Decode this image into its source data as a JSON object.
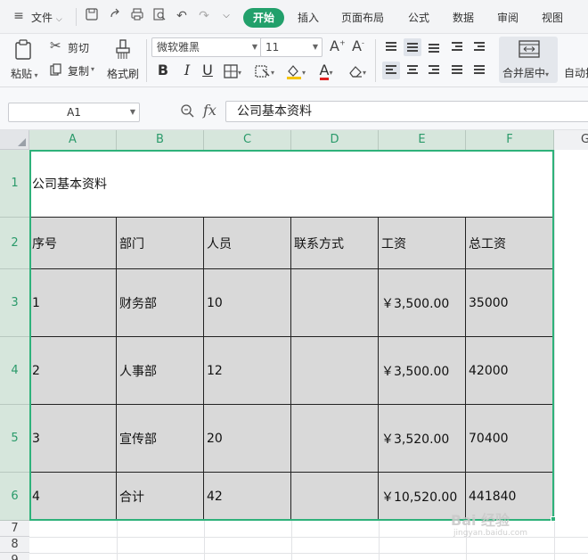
{
  "menubar": {
    "file_label": "文件",
    "tabs": [
      {
        "label": "开始",
        "active": true
      },
      {
        "label": "插入"
      },
      {
        "label": "页面布局"
      },
      {
        "label": "公式"
      },
      {
        "label": "数据"
      },
      {
        "label": "审阅"
      },
      {
        "label": "视图"
      }
    ]
  },
  "ribbon": {
    "paste": "粘贴",
    "cut": "剪切",
    "copy": "复制",
    "format_painter": "格式刷",
    "font_name": "微软雅黑",
    "font_size": "11",
    "merge_center": "合并居中",
    "auto_wrap": "自动换"
  },
  "formula_bar": {
    "name_box": "A1",
    "fx_symbol": "fx",
    "formula_value": "公司基本资料"
  },
  "sheet": {
    "columns": [
      "A",
      "B",
      "C",
      "D",
      "E",
      "F",
      "G"
    ],
    "rows": [
      "1",
      "2",
      "3",
      "4",
      "5",
      "6",
      "7",
      "8",
      "9"
    ],
    "title": "公司基本资料",
    "headers": [
      "序号",
      "部门",
      "人员",
      "联系方式",
      "工资",
      "总工资"
    ],
    "data_rows": [
      [
        "1",
        "财务部",
        "10",
        "",
        "￥3,500.00",
        "35000"
      ],
      [
        "2",
        "人事部",
        "12",
        "",
        "￥3,500.00",
        "42000"
      ],
      [
        "3",
        "宣传部",
        "20",
        "",
        "￥3,520.00",
        "70400"
      ],
      [
        "4",
        "合计",
        "42",
        "",
        "￥10,520.00",
        "441840"
      ]
    ]
  },
  "watermark": {
    "text": "Bai 经验",
    "sub": "jingyan.baidu.com"
  },
  "colors": {
    "accent": "#22a06b",
    "selection": "#2eb17a",
    "cell_fill": "#d9d9d9"
  }
}
